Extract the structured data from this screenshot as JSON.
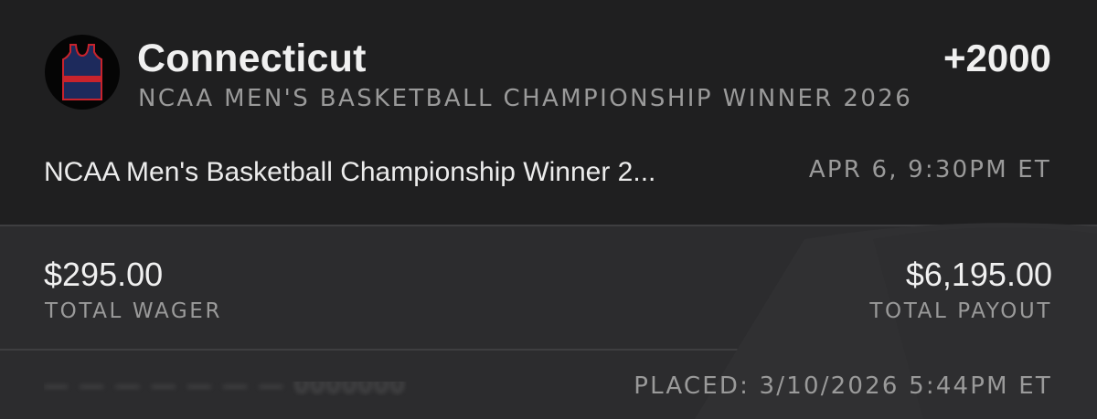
{
  "selection": {
    "team": "Connecticut",
    "odds": "+2000",
    "market": "NCAA MEN'S BASKETBALL CHAMPIONSHIP WINNER 2026",
    "jersey_icon": "basketball-jersey-icon"
  },
  "event": {
    "name": "NCAA Men's Basketball Championship Winner 2...",
    "time": "APR 6, 9:30PM ET"
  },
  "wager": {
    "amount": "$295.00",
    "label": "TOTAL WAGER"
  },
  "payout": {
    "amount": "$6,195.00",
    "label": "TOTAL PAYOUT"
  },
  "footer": {
    "bet_id": "— — — — — — — 0000000",
    "placed": "PLACED: 3/10/2026 5:44PM ET"
  },
  "colors": {
    "background_top": "#1f1f20",
    "background_bottom": "#2c2c2e",
    "text_primary": "#f0f0f0",
    "text_secondary": "#9a9a9a",
    "jersey_navy": "#1d2a5c",
    "jersey_red": "#c8232c"
  }
}
